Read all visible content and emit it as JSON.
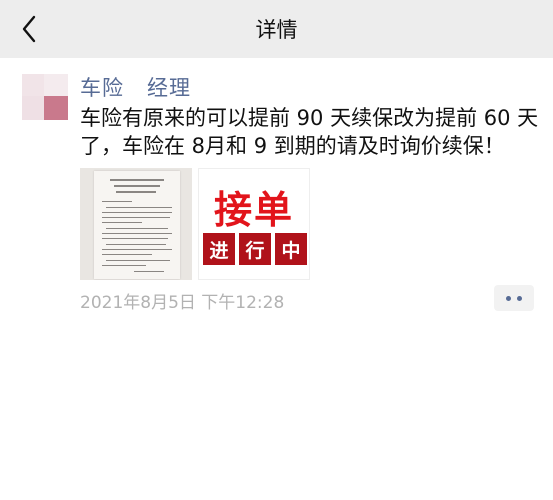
{
  "navbar": {
    "title": "详情",
    "back_icon": "chevron-left-icon"
  },
  "post": {
    "author": "车险   经理",
    "content": "车险有原来的可以提前 90 天续保改为提前 60 天了，车险在 8月和 9 到期的请及时询价续保！",
    "images": [
      {
        "name": "document-image"
      },
      {
        "name": "ad-image",
        "big_text": "接单",
        "row": [
          "进",
          "行",
          "中"
        ]
      }
    ],
    "timestamp": "2021年8月5日 下午12:28",
    "more_icon": "more-dots-icon"
  },
  "colors": {
    "navbar_bg": "#ededed",
    "link": "#576b95",
    "timestamp": "#b2b2b2",
    "ad_red": "#e2141b",
    "ad_box": "#b0121a"
  }
}
